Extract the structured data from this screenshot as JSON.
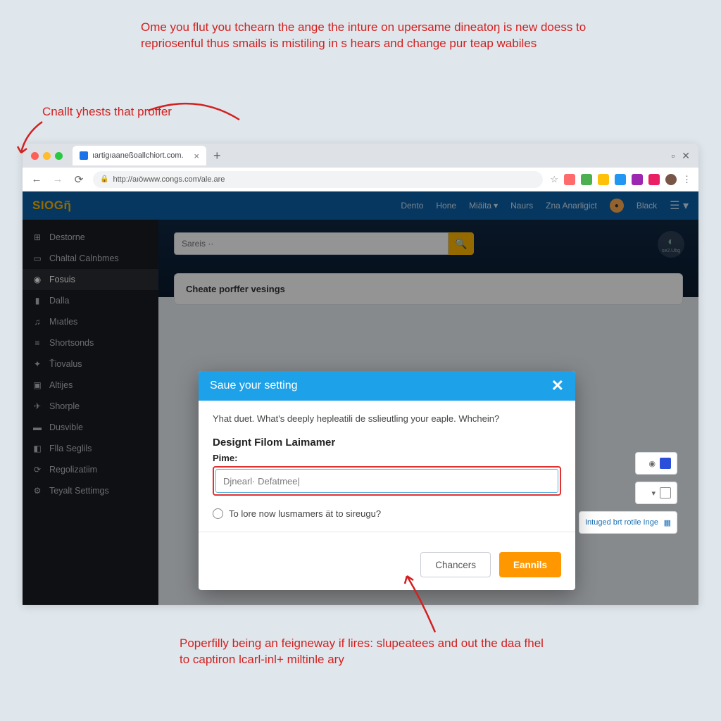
{
  "annotations": {
    "top": "Ome you flut you tchearn the ange the inture on upersame dineatoŋ is new doess to repriosenful thus smails is mistiling in s hears and change pur teap wabiles",
    "label1": "Cnallt yhests that proffer",
    "bottom": "Poperfilly being an feigneway if lires: slupeatees and out the daa fhel to captiron lcarl-inl+ miltinle ary"
  },
  "browser": {
    "tab_title": "ıartigıaaneßoallchiort.com.",
    "url": "http://aıöwww.congs.com/ale.are"
  },
  "header": {
    "logo": "SIOGῆ",
    "nav": [
      "Dento",
      "Hone",
      "Miäita",
      "Naurs",
      "Zna Anarligict"
    ],
    "user": "Black"
  },
  "sidebar": {
    "items": [
      {
        "icon": "⊞",
        "label": "Destorne"
      },
      {
        "icon": "▭",
        "label": "Chaltal Calnbmes"
      },
      {
        "icon": "◉",
        "label": "Fosuis"
      },
      {
        "icon": "▮",
        "label": "Dalla"
      },
      {
        "icon": "♫",
        "label": "Mıatles"
      },
      {
        "icon": "≡",
        "label": "Shortsonds"
      },
      {
        "icon": "✦",
        "label": "Ťiovalus"
      },
      {
        "icon": "▣",
        "label": "Altijes"
      },
      {
        "icon": "✈",
        "label": "Shorple"
      },
      {
        "icon": "▬",
        "label": "Dusvible"
      },
      {
        "icon": "◧",
        "label": "Flla Seglils"
      },
      {
        "icon": "⟳",
        "label": "Regolizatiim"
      },
      {
        "icon": "⚙",
        "label": "Teyalt Settimgs"
      }
    ]
  },
  "main": {
    "search_placeholder": "Sareis ··",
    "panel_title": "Cheate porffer vesings",
    "corner_badge": "se2.Ubg",
    "side_link": "Intuged brt rotile Inge"
  },
  "modal": {
    "title": "Saue your setting",
    "desc": "Yhat duet. What's deeply hepleatili de sslieutling your eaple. Whchein?",
    "section_title": "Designt Filom Laimamer",
    "field_label": "Pime:",
    "input_value": "Djnearl· Defatmee|",
    "radio_label": "To lore now lusmamers ät to sireugu?",
    "cancel": "Chancers",
    "confirm": "Eannils"
  }
}
